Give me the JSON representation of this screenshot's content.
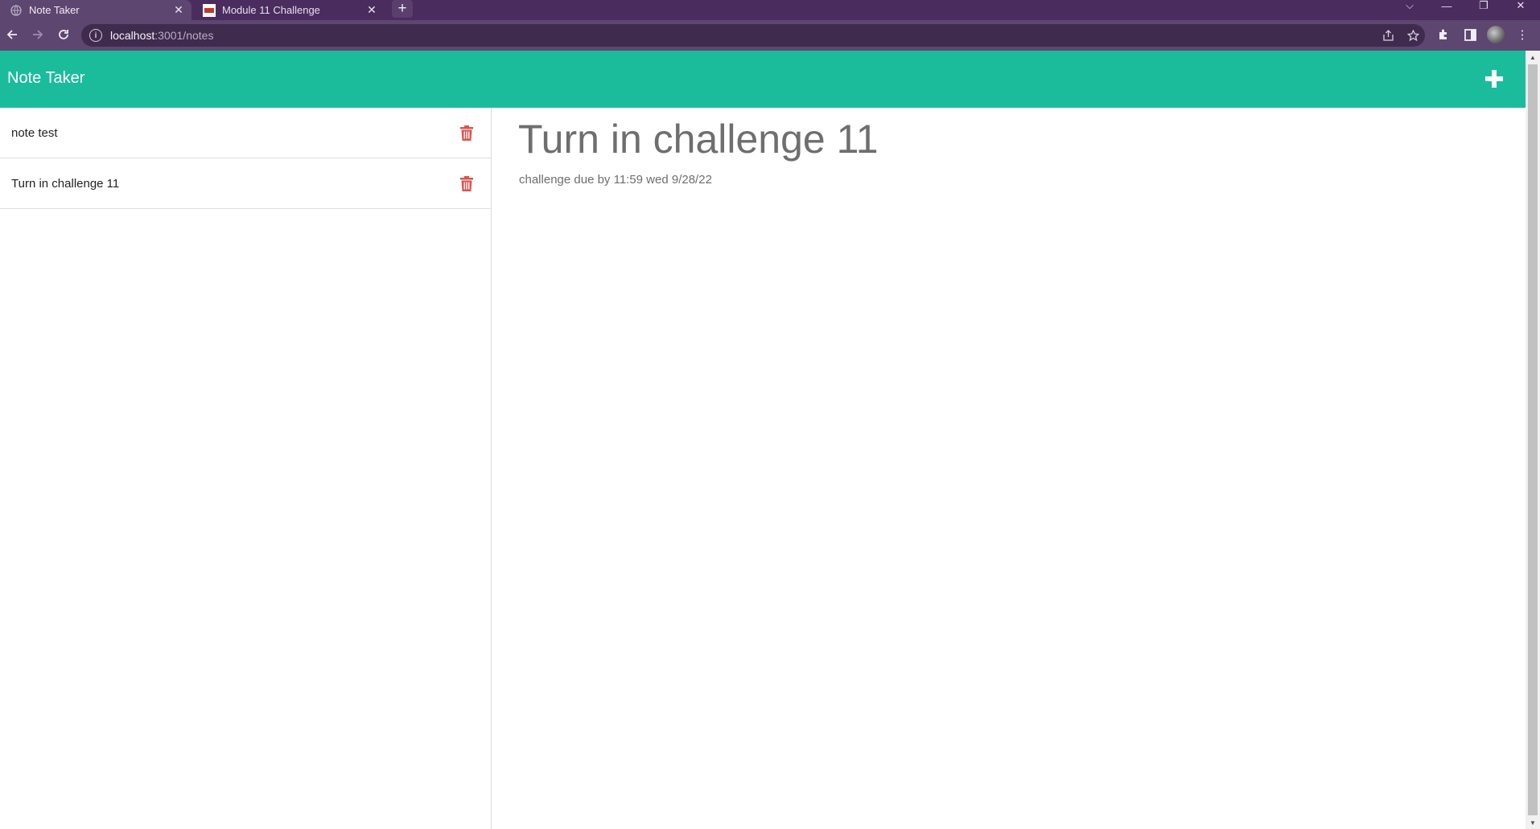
{
  "browser": {
    "tabs": [
      {
        "title": "Note Taker",
        "active": true
      },
      {
        "title": "Module 11 Challenge",
        "active": false
      }
    ],
    "url_host": "localhost",
    "url_path": ":3001/notes",
    "icons": [
      "back-icon",
      "forward-icon",
      "reload-icon",
      "info-icon",
      "share-icon",
      "star-icon",
      "extensions-icon",
      "side-panel-icon",
      "profile-avatar",
      "menu-icon"
    ]
  },
  "app": {
    "title": "Note Taker",
    "header_color": "#1abc9c",
    "add_icon": "plus-icon"
  },
  "notes": [
    {
      "title": "note test"
    },
    {
      "title": "Turn in challenge 11"
    }
  ],
  "active_note": {
    "title": "Turn in challenge 11",
    "text": "challenge due by 11:59 wed 9/28/22"
  },
  "colors": {
    "trash": "#d9534f",
    "note_text": "#6e6e6e"
  }
}
